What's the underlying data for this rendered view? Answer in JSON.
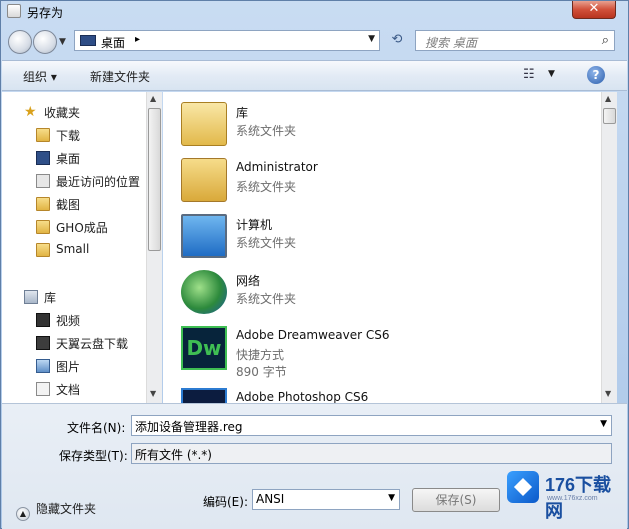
{
  "window": {
    "title": "另存为",
    "close_label": "✕"
  },
  "navigation": {
    "address_location": "桌面",
    "address_separator": "▸",
    "search_placeholder": "搜索 桌面"
  },
  "toolbar": {
    "organize_label": "组织 ▾",
    "new_folder_label": "新建文件夹",
    "help_label": "?"
  },
  "sidebar": {
    "favorites": [
      {
        "label": "收藏夹",
        "icon": "star-icon"
      },
      {
        "label": "下载",
        "icon": "folder-icon"
      },
      {
        "label": "桌面",
        "icon": "desktop-icon"
      },
      {
        "label": "最近访问的位置",
        "icon": "recent-places-icon"
      },
      {
        "label": "截图",
        "icon": "folder-icon"
      },
      {
        "label": "GHO成品",
        "icon": "folder-icon"
      },
      {
        "label": "Small",
        "icon": "folder-icon"
      }
    ],
    "libraries": [
      {
        "label": "库",
        "icon": "library-icon"
      },
      {
        "label": "视频",
        "icon": "video-icon"
      },
      {
        "label": "天翼云盘下载",
        "icon": "cloud-drive-icon"
      },
      {
        "label": "图片",
        "icon": "pictures-icon"
      },
      {
        "label": "文档",
        "icon": "documents-icon"
      }
    ]
  },
  "files": [
    {
      "name": "库",
      "type": "系统文件夹",
      "size": "",
      "icon": "library-icon"
    },
    {
      "name": "Administrator",
      "type": "系统文件夹",
      "size": "",
      "icon": "user-folder-icon"
    },
    {
      "name": "计算机",
      "type": "系统文件夹",
      "size": "",
      "icon": "computer-icon"
    },
    {
      "name": "网络",
      "type": "系统文件夹",
      "size": "",
      "icon": "network-icon"
    },
    {
      "name": "Adobe Dreamweaver CS6",
      "type": "快捷方式",
      "size": "890 字节",
      "icon": "dreamweaver-icon"
    },
    {
      "name": "Adobe Photoshop CS6",
      "type": "",
      "size": "",
      "icon": "photoshop-icon"
    }
  ],
  "form": {
    "filename_label": "文件名(N):",
    "filename_value": "添加设备管理器.reg",
    "filetype_label": "保存类型(T):",
    "filetype_value": "所有文件 (*.*)",
    "encoding_label": "编码(E):",
    "encoding_value": "ANSI",
    "save_label": "保存(S)",
    "hide_folders_label": "隐藏文件夹"
  },
  "watermark": {
    "text": "176下载网",
    "sub": "www.176xz.com"
  }
}
